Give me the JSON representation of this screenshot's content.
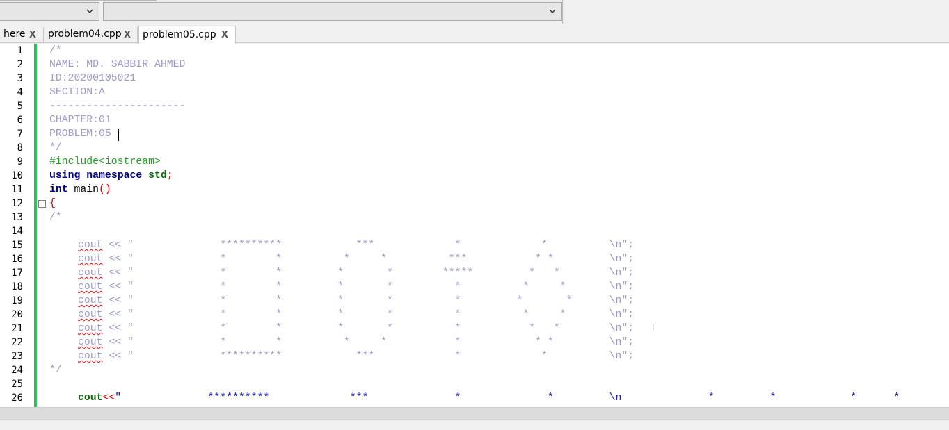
{
  "toolbar": {
    "combo1_value": "",
    "combo2_value": "",
    "combo_icon": "chevron-down-icon"
  },
  "tabs": [
    {
      "label": "here",
      "close": "X"
    },
    {
      "label": "problem04.cpp",
      "close": "X"
    },
    {
      "label": "problem05.cpp",
      "close": "X",
      "active": true
    }
  ],
  "editor": {
    "line_numbers": [
      "1",
      "2",
      "3",
      "4",
      "5",
      "6",
      "7",
      "8",
      "9",
      "10",
      "11",
      "12",
      "13",
      "14",
      "15",
      "16",
      "17",
      "18",
      "19",
      "20",
      "21",
      "22",
      "23",
      "24",
      "25",
      "26"
    ],
    "colors": {
      "comment": "#9b9bc8",
      "preprocessor": "#23a023",
      "keyword": "#00007f",
      "string": "#2020b8",
      "brace": "#d00000",
      "change_bar": "#26c94f"
    },
    "lines": {
      "l1": "/*",
      "l2": "NAME: MD. SABBIR AHMED",
      "l3": "ID:20200105021",
      "l4": "SECTION:A",
      "l5": "----------------------",
      "l6": "CHAPTER:01",
      "l7": "PROBLEM:05",
      "l8": "*/",
      "l9": "#include<iostream>",
      "l10_kw1": "using",
      "l10_kw2": "namespace",
      "l10_id": "std",
      "l10_semi": ";",
      "l11_type": "int",
      "l11_name": " main",
      "l11_paren": "()",
      "l12": "{",
      "l13": "/*",
      "cout": "cout",
      "op": " << \"",
      "l15_rest": "              **********            ***             *             *          \\n\";",
      "l16_rest": "              *        *          *     *          ***           * *         \\n\";",
      "l17_rest": "              *        *         *       *        *****         *   *        \\n\";",
      "l18_rest": "              *        *         *       *          *          *     *       \\n\";",
      "l19_rest": "              *        *         *       *          *         *       *      \\n\";",
      "l20_rest": "              *        *         *       *          *          *     *       \\n\";",
      "l21_rest": "              *        *         *       *          *           *   *        \\n\";",
      "l22_rest": "              *        *          *     *           *            * *         \\n\";",
      "l23_rest": "              **********            ***             *             *          \\n\";",
      "l24": "*/",
      "l26_cout": "cout",
      "l26_op": "<<",
      "l26_str": "\"              **********             ***              *              *         \\n              *         *            *      *"
    }
  }
}
